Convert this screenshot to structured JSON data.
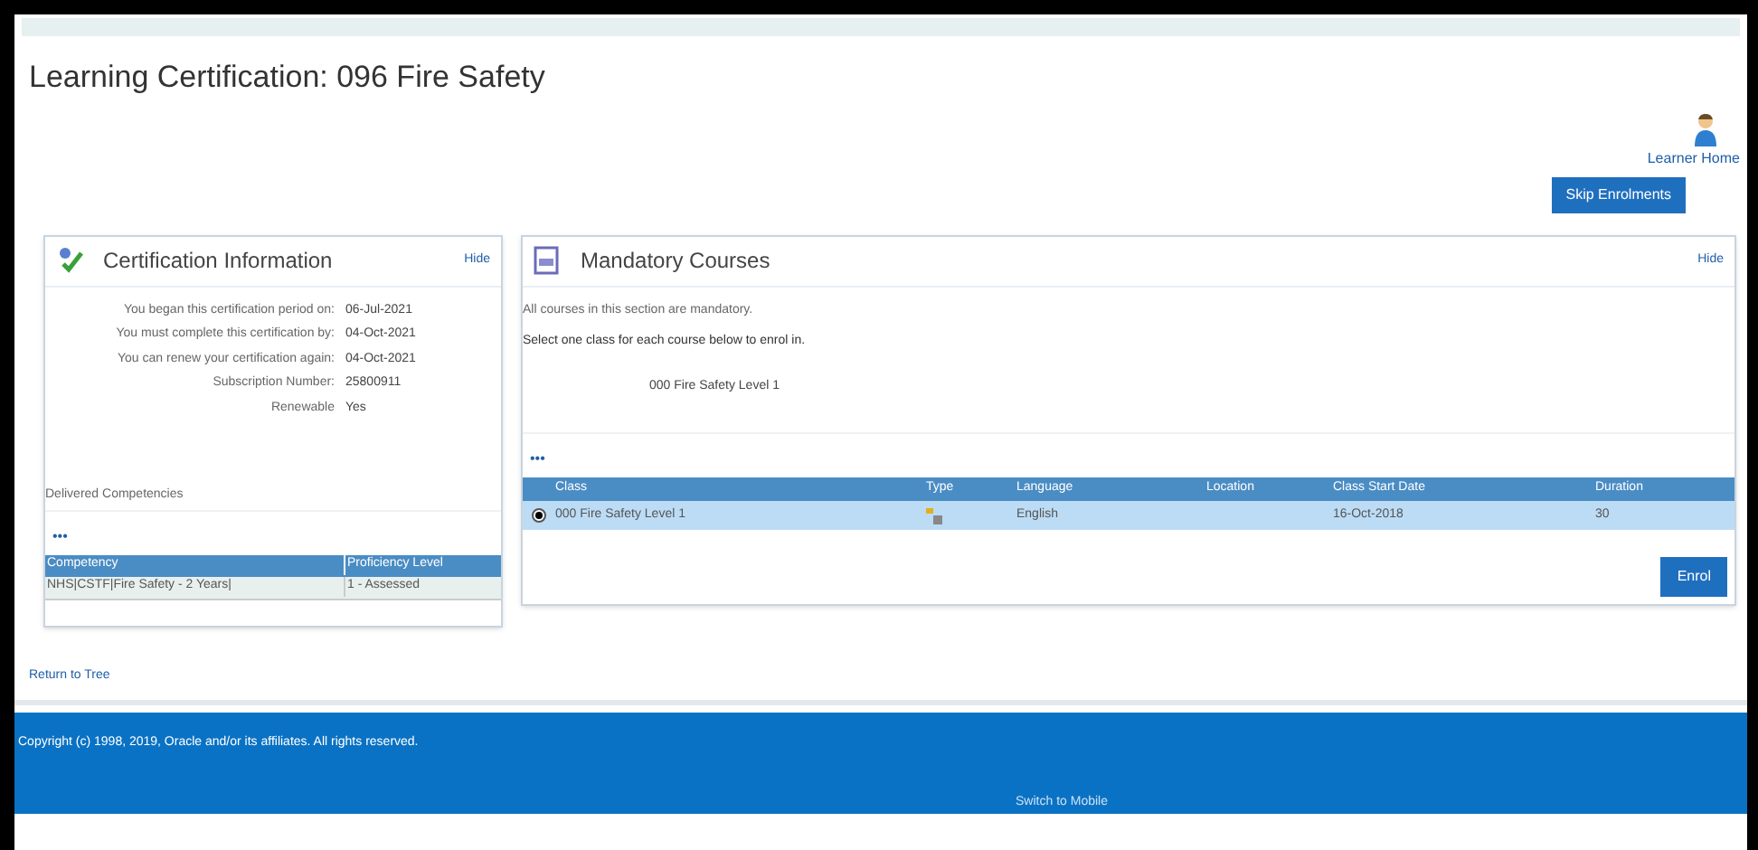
{
  "page_title": "Learning Certification: 096 Fire Safety",
  "learner_home": "Learner Home",
  "skip_button": "Skip Enrolments",
  "cert_panel": {
    "title": "Certification Information",
    "hide": "Hide",
    "fields": [
      {
        "label": "You began this certification period on:",
        "value": "06-Jul-2021"
      },
      {
        "label": "You must complete this certification by:",
        "value": "04-Oct-2021"
      },
      {
        "label": "You can renew your certification again:",
        "value": "04-Oct-2021"
      },
      {
        "label": "Subscription Number:",
        "value": "25800911"
      },
      {
        "label": "Renewable",
        "value": "Yes"
      }
    ],
    "competencies_label": "Delivered Competencies",
    "more": "•••",
    "columns": [
      "Competency",
      "Proficiency Level"
    ],
    "rows": [
      [
        "NHS|CSTF|Fire Safety - 2 Years|",
        "1 - Assessed"
      ]
    ]
  },
  "courses_panel": {
    "title": "Mandatory Courses",
    "hide": "Hide",
    "note": "All courses in this section are mandatory.",
    "instruction": "Select one class for each course below to enrol in.",
    "course_name": "000 Fire Safety Level 1",
    "more": "•••",
    "columns": [
      "Class",
      "Type",
      "Language",
      "Location",
      "Class Start Date",
      "Duration"
    ],
    "rows": [
      {
        "selected": true,
        "class": "000 Fire Safety Level 1",
        "language": "English",
        "location": "",
        "start": "16-Oct-2018",
        "duration": "30"
      }
    ],
    "enrol_button": "Enrol"
  },
  "return_link": "Return to Tree",
  "footer": {
    "copyright": "Copyright (c) 1998, 2019, Oracle and/or its affiliates. All rights reserved.",
    "mobile_link": "Switch to Mobile"
  }
}
